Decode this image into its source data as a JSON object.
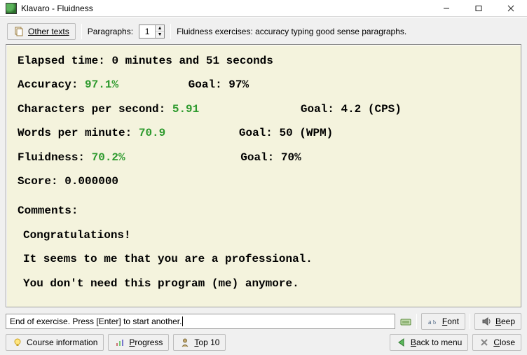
{
  "window": {
    "title": "Klavaro - Fluidness"
  },
  "toolbar": {
    "other_texts": "Other texts",
    "paragraphs_label": "Paragraphs:",
    "paragraphs_value": "1",
    "description": "Fluidness exercises: accuracy typing good sense paragraphs."
  },
  "results": {
    "elapsed_label": "Elapsed time:",
    "elapsed_value": "0 minutes and 51 seconds",
    "accuracy_label": "Accuracy:",
    "accuracy_value": "97.1%",
    "accuracy_goal": "Goal: 97%",
    "cps_label": "Characters per second:",
    "cps_value": "5.91",
    "cps_goal": "Goal: 4.2 (CPS)",
    "wpm_label": "Words per minute:",
    "wpm_value": "70.9",
    "wpm_goal": "Goal: 50 (WPM)",
    "fluid_label": "Fluidness:",
    "fluid_value": "70.2%",
    "fluid_goal": "Goal: 70%",
    "score_label": "Score:",
    "score_value": "0.000000",
    "comments_label": "Comments:",
    "comment_line1": "Congratulations!",
    "comment_line2": "It seems to me that you are a professional.",
    "comment_line3": "You don't need this program (me) anymore."
  },
  "input": {
    "value": "End of exercise. Press [Enter] to start another."
  },
  "buttons": {
    "font": "Font",
    "beep": "Beep",
    "course_info": "Course information",
    "progress": "Progress",
    "top10": "Top 10",
    "back": "Back to menu",
    "close": "Close"
  }
}
